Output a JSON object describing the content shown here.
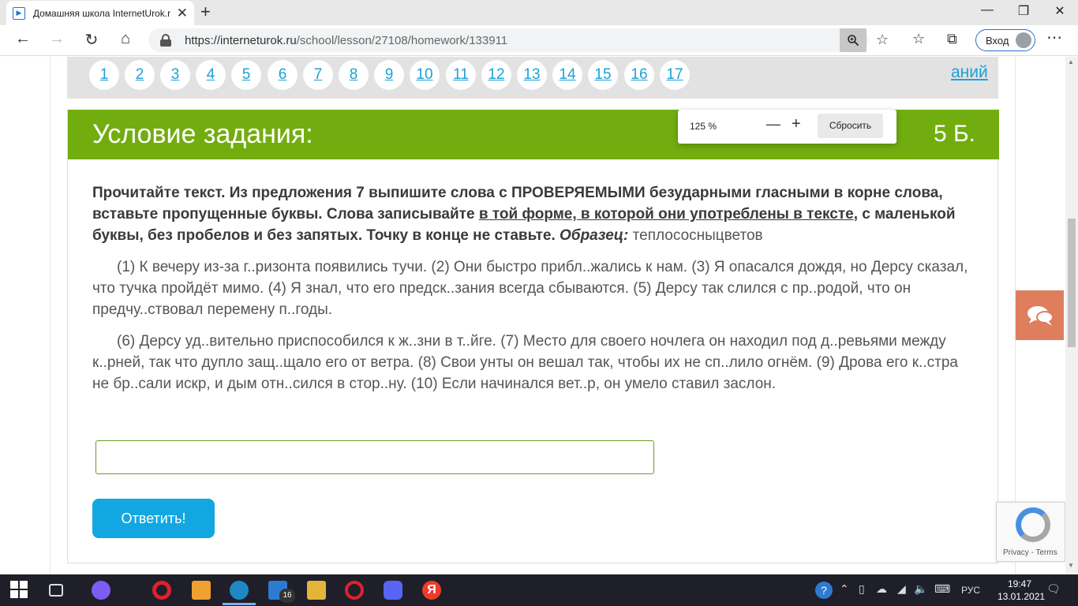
{
  "browser": {
    "tab_title": "Домашняя школа InternetUrok.r",
    "tab_close": "✕",
    "new_tab": "+",
    "url_host": "https://interneturok.ru",
    "url_path": "/school/lesson/27108/homework/133911",
    "signin_label": "Вход",
    "window_min": "—",
    "window_max": "❐",
    "window_close": "✕"
  },
  "zoom_popup": {
    "level": "125 %",
    "minus": "—",
    "plus": "+",
    "reset_label": "Сбросить"
  },
  "task_nav": {
    "numbers": [
      "1",
      "2",
      "3",
      "4",
      "5",
      "6",
      "7",
      "8",
      "9",
      "10",
      "11",
      "12",
      "13",
      "14",
      "15",
      "16",
      "17"
    ],
    "tasks_link_tail": "аний"
  },
  "card": {
    "title": "Условие задания:",
    "points": "5 Б.",
    "instruction_part1": "Прочитайте текст. Из предложения 7 выпишите слова с ПРОВЕРЯЕМЫМИ безударными гласными в корне слова, вставьте пропущенные буквы. Слова записывайте ",
    "instruction_underlined": "в той форме, в которой они употреблены в тексте",
    "instruction_part2": ", с маленькой буквы, без пробелов и без запятых. Точку в конце не ставьте. ",
    "sample_label": "Образец:",
    "sample_value": " теплососныцветов",
    "paragraph1": "(1) К вечеру из-за г..ризонта появились тучи. (2) Они быстро прибл..жались к нам. (3) Я опасался дождя, но Дерсу сказал, что тучка пройдёт мимо. (4) Я знал, что его предск..зания всегда сбываются. (5) Дерсу так слился с пр..родой, что он предчу..ствовал перемену п..годы.",
    "paragraph2": "(6) Дерсу уд..вительно приспособился к ж..зни в т..йге. (7) Место для своего ночлега он находил под д..ревьями между к..рней, так что дупло защ..щало его от ветра. (8) Свои унты он вешал так, чтобы их не сп..лило огнём. (9) Дрова его к..стра не бр..сали искр, и дым отн..сился в стор..ну. (10) Если начинался вет..р, он умело ставил заслон.",
    "answer_value": "",
    "submit_label": "Ответить!"
  },
  "recaptcha": {
    "text": "Privacy - Terms"
  },
  "taskbar": {
    "mail_badge": "16",
    "yandex_letter": "Я",
    "help_glyph": "?",
    "lang": "РУС",
    "time": "19:47",
    "date": "13.01.2021"
  },
  "colors": {
    "header_green": "#72ad0f",
    "link_blue": "#1aa2d8",
    "submit_blue": "#13a7e2",
    "chat_orange": "#de7e5c"
  }
}
